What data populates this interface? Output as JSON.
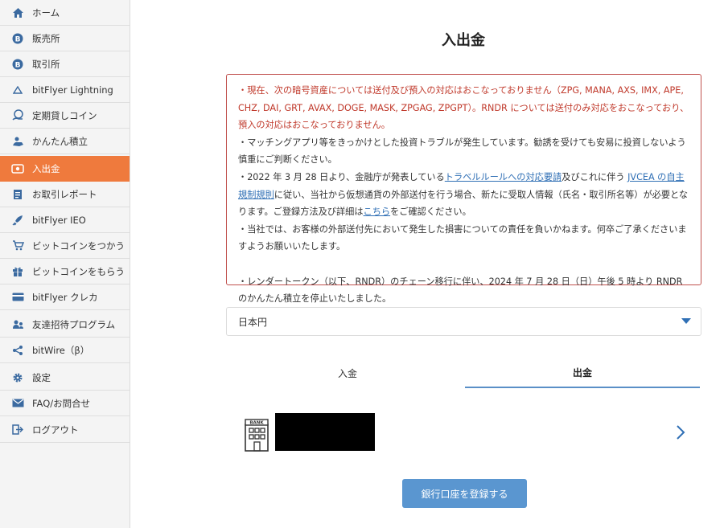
{
  "sidebar": {
    "items": [
      {
        "label": "ホーム",
        "icon": "home-icon"
      },
      {
        "label": "販売所",
        "icon": "bitcoin-icon"
      },
      {
        "label": "取引所",
        "icon": "bitcoin-icon"
      },
      {
        "label": "bitFlyer Lightning",
        "icon": "lightning-icon"
      },
      {
        "label": "定期貸しコイン",
        "icon": "coin-lending-icon"
      },
      {
        "label": "かんたん積立",
        "icon": "savings-icon"
      },
      {
        "label": "入出金",
        "icon": "wallet-icon",
        "active": true
      },
      {
        "label": "お取引レポート",
        "icon": "report-icon"
      },
      {
        "label": "bitFlyer IEO",
        "icon": "rocket-icon"
      },
      {
        "label": "ビットコインをつかう",
        "icon": "cart-icon"
      },
      {
        "label": "ビットコインをもらう",
        "icon": "gift-icon"
      },
      {
        "label": "bitFlyer クレカ",
        "icon": "credit-card-icon"
      },
      {
        "label": "友達招待プログラム",
        "icon": "invite-friends-icon"
      },
      {
        "label": "bitWire（β）",
        "icon": "share-icon"
      },
      {
        "label": "設定",
        "icon": "gear-icon"
      },
      {
        "label": "FAQ/お問合せ",
        "icon": "mail-icon"
      },
      {
        "label": "ログアウト",
        "icon": "logout-icon"
      }
    ],
    "active_color": "#ef7a3d"
  },
  "main": {
    "title": "入出金",
    "notice": {
      "red_text": "・現在、次の暗号資産については送付及び預入の対応はおこなっておりません（ZPG, MANA, AXS, IMX, APE, CHZ, DAI, GRT, AVAX, DOGE, MASK, ZPGAG, ZPGPT）。RNDR については送付のみ対応をおこなっており、預入の対応はおこなっておりません。",
      "line2": "・マッチングアプリ等をきっかけとした投資トラブルが発生しています。勧誘を受けても安易に投資しないよう慎重にご判断ください。",
      "line3_pre": "・2022 年 3 月 28 日より、金融庁が発表している",
      "line3_link1": "トラベルルールへの対応要請",
      "line3_mid": "及びこれに伴う ",
      "line3_link2": "JVCEA の自主規制規則",
      "line3_post": "に従い、当社から仮想通貨の外部送付を行う場合、新たに受取人情報（氏名・取引所名等）が必要となります。ご登録方法及び詳細は",
      "line3_link3": "こちら",
      "line3_end": "をご確認ください。",
      "line4": "・当社では、お客様の外部送付先において発生した損害についての責任を負いかねます。何卒ご了承くださいますようお願いいたします。",
      "line5": "・レンダートークン（以下、RNDR）のチェーン移行に伴い、2024 年 7 月 28 日（日）午後 5 時より RNDR のかんたん積立を停止いたしました。"
    },
    "currency_select": {
      "value": "日本円"
    },
    "tabs": [
      {
        "label": "入金"
      },
      {
        "label": "出金",
        "active": true
      }
    ],
    "bank_account": {
      "icon": "bank-icon",
      "icon_text": "BANK"
    },
    "register_button": "銀行口座を登録する"
  },
  "colors": {
    "notice_border": "#c0504d",
    "notice_red": "#c0392b",
    "link": "#2f6fb5",
    "button": "#5a96d0",
    "tab_underline": "#5a8fc7"
  }
}
